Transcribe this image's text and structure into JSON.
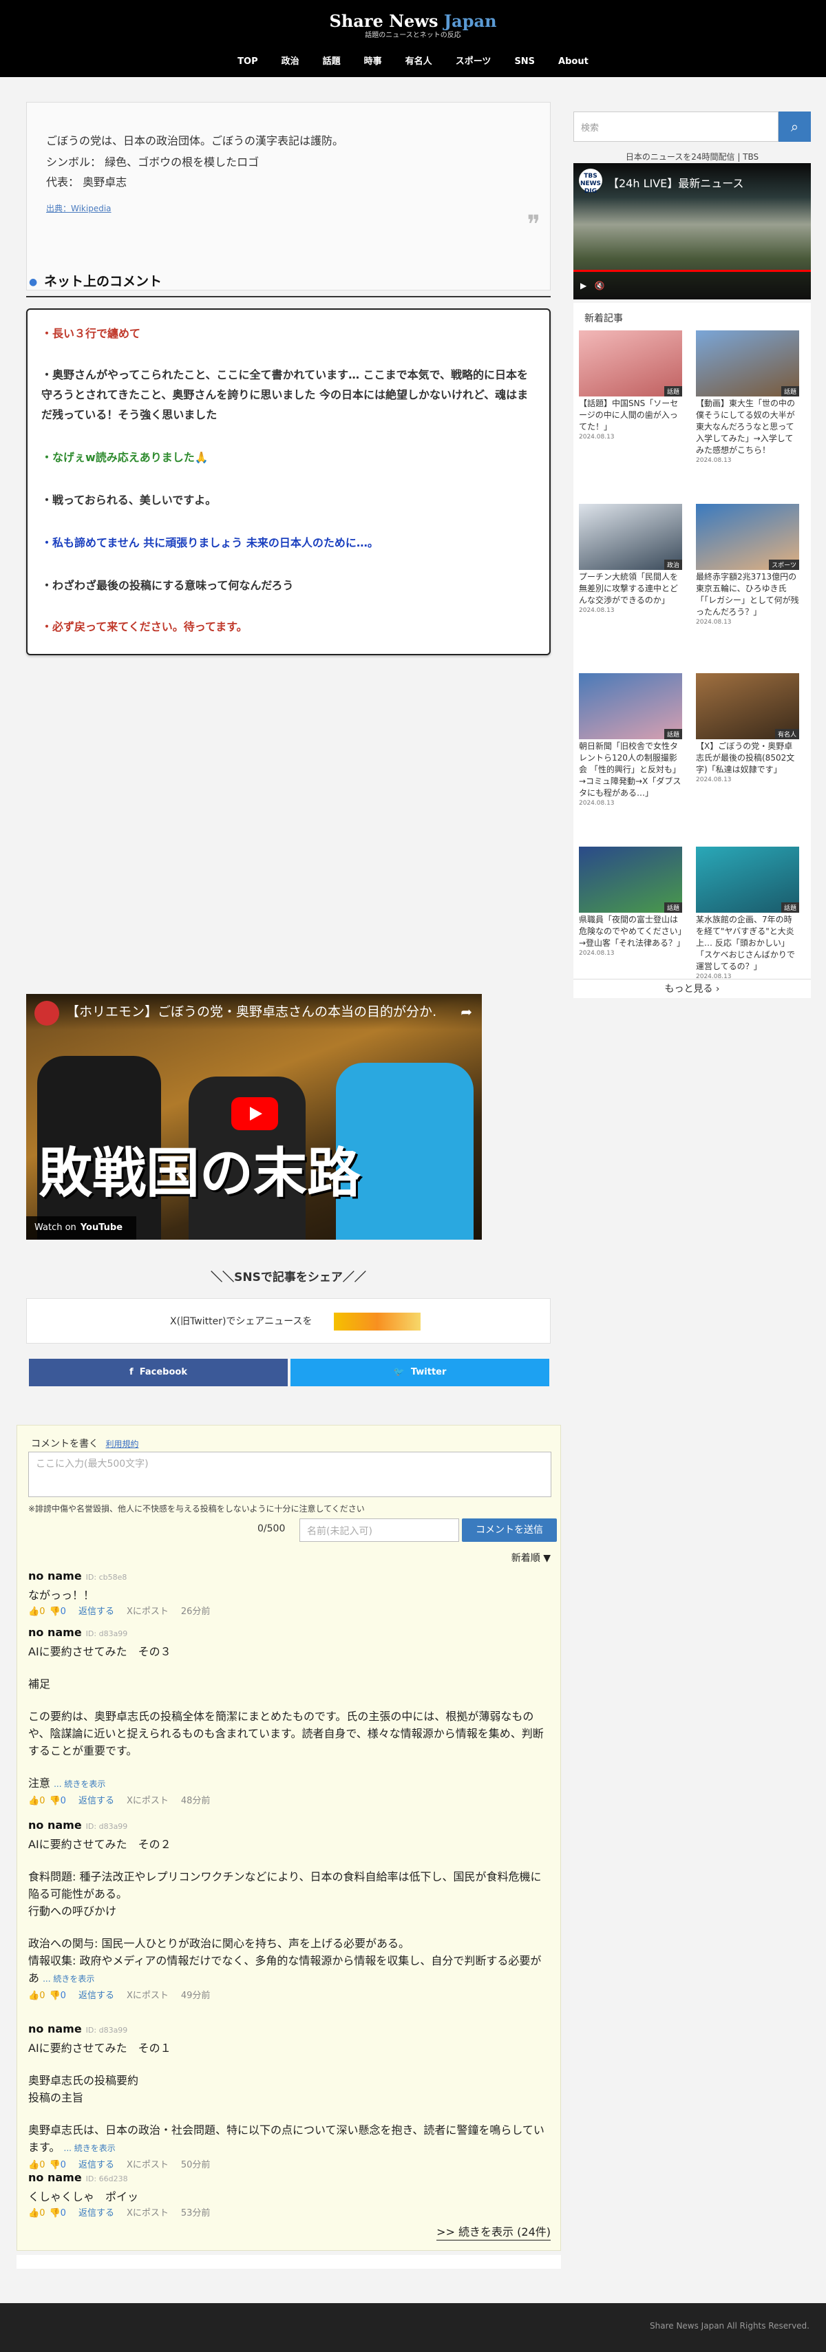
{
  "header": {
    "logo_main": "Share News",
    "logo_accent": "Japan",
    "tagline": "話題のニュースとネットの反応",
    "nav": [
      "TOP",
      "政治",
      "話題",
      "時事",
      "有名人",
      "スポーツ",
      "SNS",
      "About"
    ]
  },
  "party": {
    "line1": "ごぼうの党は、日本の政治団体。ごぼうの漢字表記は護防。",
    "line2": "シンボル： 緑色、ゴボウの根を模したロゴ",
    "line3": "代表： 奥野卓志",
    "source": "出典：Wikipedia"
  },
  "net_comments": {
    "heading": "ネット上のコメント",
    "items": [
      {
        "text": "・長い３行で纏めて",
        "color": "#c0392b"
      },
      {
        "text": "・奥野さんがやってこられたこと、ここに全て書かれています… ここまで本気で、戦略的に日本を守ろうとされてきたこと、奥野さんを誇りに思いました 今の日本には絶望しかないけれど、魂はまだ残っている！そう強く思いました",
        "color": "#333333"
      },
      {
        "text": "・なげぇw読み応えありました🙏",
        "color": "#2e8b2e"
      },
      {
        "text": "・戦っておられる、美しいですよ。",
        "color": "#333333"
      },
      {
        "text": "・私も諦めてません 共に頑張りましょう 未来の日本人のために…。",
        "color": "#1a3fbf"
      },
      {
        "text": "・わざわざ最後の投稿にする意味って何なんだろう",
        "color": "#333333"
      },
      {
        "text": "・必ず戻って来てください。待ってます。",
        "color": "#c0392b"
      }
    ]
  },
  "video": {
    "title": "【ホリエモン】ごぼうの党・奥野卓志さんの本当の目的が分か…",
    "big_text": "敗戦国の末路",
    "watch_on": "Watch on",
    "youtube": "YouTube"
  },
  "share": {
    "heading": "＼＼SNSで記事をシェア／／",
    "x_text": "X(旧Twitter)でシェアニュースを",
    "facebook": "Facebook",
    "twitter": "Twitter"
  },
  "comment_form": {
    "write_label": "コメントを書く",
    "terms": "利用規約",
    "textarea_placeholder": "ここに入力(最大500文字)",
    "warning": "※誹謗中傷や名誉毀損、他人に不快感を与える投稿をしないように十分に注意してください",
    "count": "0/500",
    "name_placeholder": "名前(未記入可)",
    "submit": "コメントを送信",
    "sort": "新着順 ▼",
    "more": ">> 続きを表示 (24件)"
  },
  "comments": [
    {
      "name": "no name",
      "id": "ID: cb58e8",
      "body": [
        "ながっっ！！"
      ],
      "more": "",
      "likes": "0",
      "dislikes": "0",
      "reply": "返信する",
      "xpost": "Xにポスト",
      "time": "26分前"
    },
    {
      "name": "no name",
      "id": "ID: d83a99",
      "body": [
        "AIに要約させてみた　その３",
        "補足",
        "この要約は、奥野卓志氏の投稿全体を簡潔にまとめたものです。氏の主張の中には、根拠が薄弱なものや、陰謀論に近いと捉えられるものも含まれています。読者自身で、様々な情報源から情報を集め、判断することが重要です。",
        "注意"
      ],
      "more": "... 続きを表示",
      "likes": "0",
      "dislikes": "0",
      "reply": "返信する",
      "xpost": "Xにポスト",
      "time": "48分前"
    },
    {
      "name": "no name",
      "id": "ID: d83a99",
      "body": [
        "AIに要約させてみた　その２",
        "食料問題: 種子法改正やレプリコンワクチンなどにより、日本の食料自給率は低下し、国民が食料危機に陥る可能性がある。",
        "行動への呼びかけ",
        "政治への関与: 国民一人ひとりが政治に関心を持ち、声を上げる必要がある。",
        "情報収集: 政府やメディアの情報だけでなく、多角的な情報源から情報を収集し、自分で判断する必要があ"
      ],
      "more": "... 続きを表示",
      "likes": "0",
      "dislikes": "0",
      "reply": "返信する",
      "xpost": "Xにポスト",
      "time": "49分前"
    },
    {
      "name": "no name",
      "id": "ID: d83a99",
      "body": [
        "AIに要約させてみた　その１",
        "奥野卓志氏の投稿要約",
        "投稿の主旨",
        "奥野卓志氏は、日本の政治・社会問題、特に以下の点について深い懸念を抱き、読者に警鐘を鳴らしています。"
      ],
      "more": "... 続きを表示",
      "likes": "0",
      "dislikes": "0",
      "reply": "返信する",
      "xpost": "Xにポスト",
      "time": "50分前"
    },
    {
      "name": "no name",
      "id": "ID: 66d238",
      "body": [
        "くしゃくしゃ　ポイッ"
      ],
      "more": "",
      "likes": "0",
      "dislikes": "0",
      "reply": "返信する",
      "xpost": "Xにポスト",
      "time": "53分前"
    }
  ],
  "sidebar": {
    "search_placeholder": "検索",
    "live_caption": "日本のニュースを24時間配信 | TBS",
    "live_title": "【24h LIVE】最新ニュース",
    "live_logo": "TBS NEWS DIG",
    "new_heading": "新着記事",
    "more": "もっと見る ›",
    "articles": [
      {
        "title": "【話題】中国SNS「ソーセージの中に人間の歯が入ってた！」",
        "date": "2024.08.13",
        "tag": "話題",
        "c1": "#f2b8b8",
        "c2": "#c06060"
      },
      {
        "title": "【動画】東大生「世の中の僕そうにしてる奴の大半が東大なんだろうなと思って入学してみた」→入学してみた感想がこちら！",
        "date": "2024.08.13",
        "tag": "話題",
        "c1": "#7aa6d8",
        "c2": "#7a5a3a"
      },
      {
        "title": "プーチン大統領「民間人を無差別に攻撃する連中とどんな交渉ができるのか」",
        "date": "2024.08.13",
        "tag": "政治",
        "c1": "#dde3ea",
        "c2": "#3a4a5a"
      },
      {
        "title": "最終赤字額2兆3713億円の東京五輪に、ひろゆき氏「「レガシー」として何が残ったんだろう？」",
        "date": "2024.08.13",
        "tag": "スポーツ",
        "c1": "#3a7abf",
        "c2": "#e0b080"
      },
      {
        "title": "朝日新聞「旧校舎で女性タレントら120人の制服撮影会 「性的興行」と反対も」→コミュ障発動→X「ダブスタにも程がある…」",
        "date": "2024.08.13",
        "tag": "話題",
        "c1": "#4a7ab8",
        "c2": "#d8a0b0"
      },
      {
        "title": "【X】ごぼうの党・奥野卓志氏が最後の投稿(8502文字)「私達は奴隷です」",
        "date": "2024.08.13",
        "tag": "有名人",
        "c1": "#a07040",
        "c2": "#3a2a1a"
      },
      {
        "title": "県職員「夜間の富士登山は危険なのでやめてください」→登山客「それ法律ある？」",
        "date": "2024.08.13",
        "tag": "話題",
        "c1": "#2a4a8a",
        "c2": "#4a9a4a"
      },
      {
        "title": "某水族館の企画、7年の時を経て\"ヤバすぎる\"と大炎上… 反応「頭おかしい」「スケベおじさんばかりで運営してるの？」",
        "date": "2024.08.13",
        "tag": "話題",
        "c1": "#2aa8b8",
        "c2": "#1a5a6a"
      }
    ]
  },
  "footer": {
    "copyright": "Share News Japan All Rights Reserved."
  }
}
